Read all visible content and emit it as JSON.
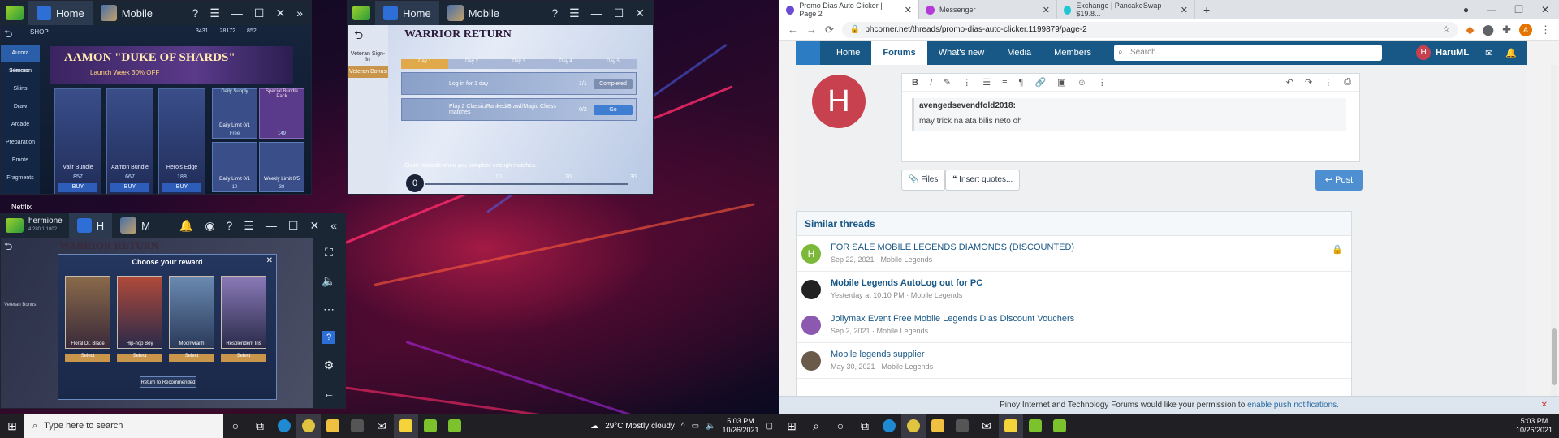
{
  "emulator_shop": {
    "tab_home": "Home",
    "tab_app": "Mobile",
    "shop_label": "SHOP",
    "side_items": [
      "Aurora Summon",
      "Heroes",
      "Skins",
      "Draw",
      "Arcade",
      "Preparation",
      "Emote",
      "Fragments"
    ],
    "banner_title": "AAMON \"DUKE OF SHARDS\"",
    "banner_sub": "Launch Week 30% OFF",
    "cards": [
      {
        "name": "Valir Bundle",
        "price": "857",
        "buy": "BUY"
      },
      {
        "name": "Aamon Bundle",
        "price": "667",
        "buy": "BUY"
      },
      {
        "name": "Hero's Edge",
        "price": "188",
        "buy": "BUY"
      }
    ],
    "side_boxes": [
      {
        "title": "Daily Supply",
        "value": "Daily Limit 0/1",
        "price": "Free"
      },
      {
        "title": "Special Bundle Pack",
        "value": "",
        "price": "149"
      },
      {
        "title": "",
        "value": "Daily Limit 0/1",
        "price": "10"
      },
      {
        "title": "",
        "value": "Weekly Limit 0/5",
        "price": "38"
      }
    ],
    "currency": [
      "3431",
      "28172",
      "852"
    ],
    "netflix_label": "Netflix"
  },
  "emulator_warrior": {
    "tab_home": "Home",
    "tab_app": "Mobile",
    "left_items": [
      "Veteran Sign-In",
      "Veteran Bonus"
    ],
    "title": "WARRIOR RETURN",
    "days": [
      "Day 1",
      "Day 2",
      "Day 3",
      "Day 4",
      "Day 5"
    ],
    "tasks": [
      {
        "text": "Log in for 1 day",
        "progress": "1/1",
        "button": "Completed"
      },
      {
        "text": "Play 2 Classic/Ranked/Brawl/Magic Chess matches",
        "progress": "0/2",
        "button": "Go"
      }
    ],
    "claim_text": "Claim rewards when you complete enough matches.",
    "points": "0",
    "milestones": [
      "10",
      "20",
      "30"
    ]
  },
  "emulator_reward": {
    "instance_name": "hermione",
    "instance_version": "4.280.1.1002",
    "tab_h": "H",
    "tab_m": "M",
    "bg_title": "WARRIOR RETURN",
    "dialog_title": "Choose your reward",
    "rewards": [
      {
        "name": "Floral Dr. Blade",
        "btn": "Select"
      },
      {
        "name": "Hip-hop Boy",
        "btn": "Select"
      },
      {
        "name": "Moonwraith",
        "btn": "Select"
      },
      {
        "name": "Resplendent Iris",
        "btn": "Select"
      }
    ],
    "return_label": "Return to Recommended",
    "left_label": "Veteran Bonus"
  },
  "browser": {
    "tabs": [
      {
        "title": "Promo Dias Auto Clicker | Page 2",
        "color": "#6b4bd6"
      },
      {
        "title": "Messenger",
        "color": "#b43bd8"
      },
      {
        "title": "Exchange | PancakeSwap - $19.8...",
        "color": "#1fc7d4"
      }
    ],
    "url": "phcorner.net/threads/promo-dias-auto-clicker.1199879/page-2",
    "nav": [
      "Home",
      "Forums",
      "What's new",
      "Media",
      "Members"
    ],
    "search_placeholder": "Search...",
    "user": "HaruML",
    "avatar_letter": "H",
    "quote_author": "avengedsevendfold2018:",
    "quote_text": "may trick na ata bilis neto oh",
    "files_btn": "Files",
    "insert_quotes_btn": "Insert quotes...",
    "post_btn": "Post",
    "similar_title": "Similar threads",
    "threads": [
      {
        "title": "FOR SALE MOBILE LEGENDS DIAMONDS (DISCOUNTED)",
        "meta": "Sep 22, 2021 · Mobile Legends",
        "color": "#7cb83a"
      },
      {
        "title": "Mobile Legends AutoLog out for PC",
        "meta": "Yesterday at 10:10 PM · Mobile Legends",
        "color": "#222222"
      },
      {
        "title": "Jollymax Event Free Mobile Legends Dias Discount Vouchers",
        "meta": "Sep 2, 2021 · Mobile Legends",
        "color": "#8b5ab0"
      },
      {
        "title": "Mobile legends supplier",
        "meta": "May 30, 2021 · Mobile Legends",
        "color": "#6a5a4a"
      }
    ],
    "push_text": "Pinoy Internet and Technology Forums would like your permission to",
    "push_link": "enable push notifications."
  },
  "taskbar_left": {
    "search_placeholder": "Type here to search",
    "weather": "29°C  Mostly cloudy",
    "time": "5:03 PM",
    "date": "10/26/2021"
  },
  "taskbar_right": {
    "time": "5:03 PM",
    "date": "10/26/2021"
  }
}
